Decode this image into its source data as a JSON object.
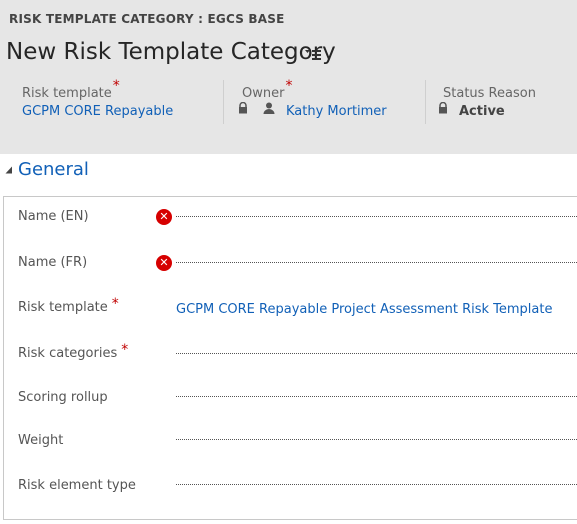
{
  "header": {
    "entity_title": "RISK TEMPLATE CATEGORY : EGCS BASE",
    "record_title": "New Risk Template Category",
    "fields": {
      "risk_template": {
        "label": "Risk template",
        "required": "*",
        "value": "GCPM CORE Repayable"
      },
      "owner": {
        "label": "Owner",
        "required": "*",
        "value": "Kathy Mortimer"
      },
      "status_reason": {
        "label": "Status Reason",
        "value": "Active"
      }
    }
  },
  "section": {
    "title": "General"
  },
  "form": {
    "name_en": {
      "label": "Name (EN)",
      "value": ""
    },
    "name_fr": {
      "label": "Name (FR)",
      "value": ""
    },
    "risk_template": {
      "label": "Risk template",
      "required": "*",
      "value": "GCPM CORE Repayable Project Assessment Risk Template"
    },
    "risk_categories": {
      "label": "Risk categories",
      "required": "*",
      "value": ""
    },
    "scoring_rollup": {
      "label": "Scoring rollup",
      "value": ""
    },
    "weight": {
      "label": "Weight",
      "value": ""
    },
    "risk_element_type": {
      "label": "Risk element type",
      "value": ""
    }
  },
  "colors": {
    "header_bg": "#e6e6e6",
    "link": "#1160b7",
    "required": "#c00000",
    "error": "#d60000"
  },
  "icons": [
    "form-menu-icon",
    "lock-icon",
    "user-icon",
    "error-icon",
    "collapse-triangle-icon"
  ]
}
